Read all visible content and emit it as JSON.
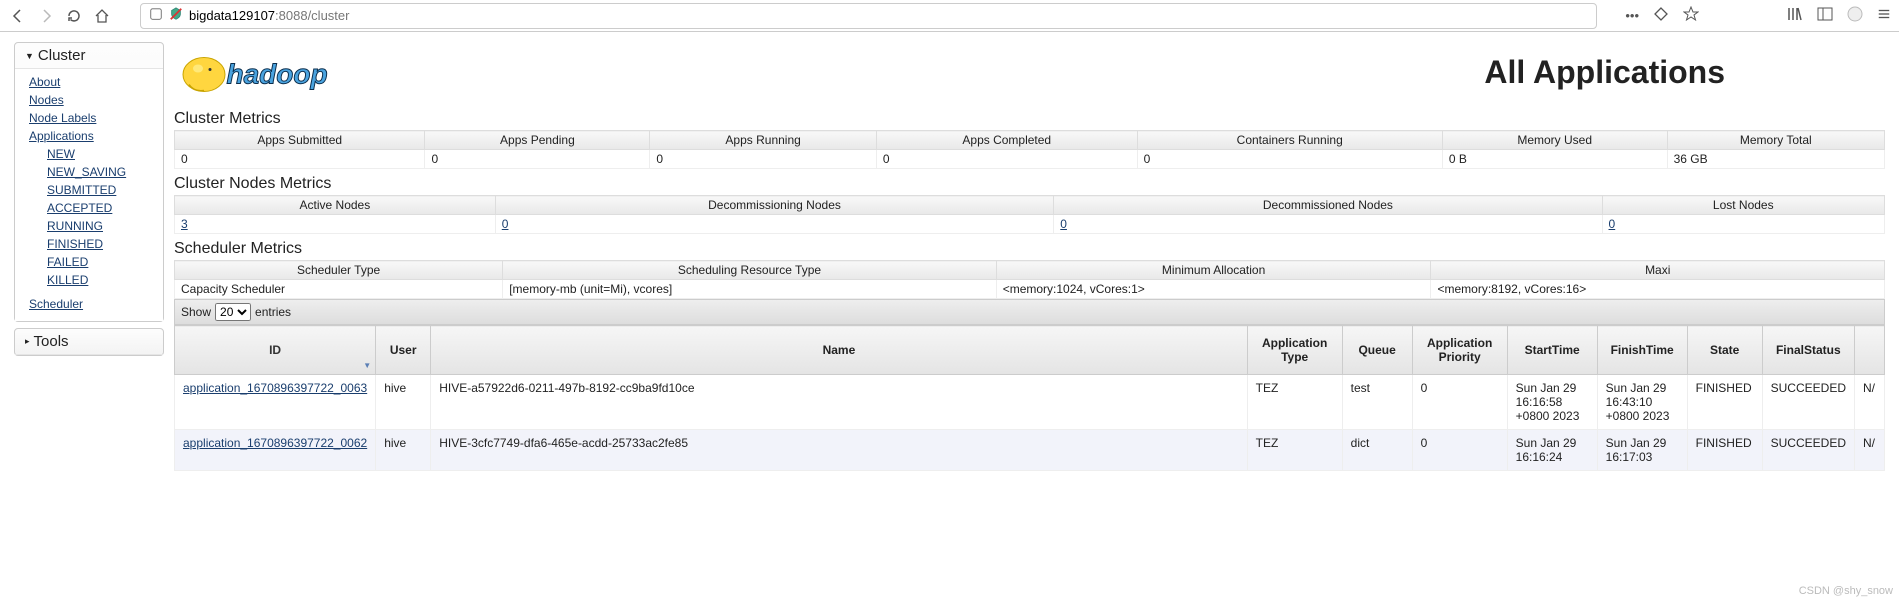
{
  "browser": {
    "url_host": "bigdata129107",
    "url_rest": ":8088/cluster"
  },
  "page": {
    "title": "All Applications"
  },
  "sidebar": {
    "panels": [
      {
        "title": "Cluster"
      },
      {
        "title": "Tools"
      }
    ],
    "cluster_links": [
      "About",
      "Nodes",
      "Node Labels",
      "Applications"
    ],
    "app_states": [
      "NEW",
      "NEW_SAVING",
      "SUBMITTED",
      "ACCEPTED",
      "RUNNING",
      "FINISHED",
      "FAILED",
      "KILLED"
    ],
    "scheduler_link": "Scheduler"
  },
  "cluster_metrics": {
    "heading": "Cluster Metrics",
    "headers": [
      "Apps Submitted",
      "Apps Pending",
      "Apps Running",
      "Apps Completed",
      "Containers Running",
      "Memory Used",
      "Memory Total"
    ],
    "values": [
      "0",
      "0",
      "0",
      "0",
      "0",
      "0 B",
      "36 GB"
    ]
  },
  "nodes_metrics": {
    "heading": "Cluster Nodes Metrics",
    "headers": [
      "Active Nodes",
      "Decommissioning Nodes",
      "Decommissioned Nodes",
      "Lost Nodes"
    ],
    "values": [
      "3",
      "0",
      "0",
      "0"
    ]
  },
  "scheduler_metrics": {
    "heading": "Scheduler Metrics",
    "headers": [
      "Scheduler Type",
      "Scheduling Resource Type",
      "Minimum Allocation",
      "Maxi"
    ],
    "values": [
      "Capacity Scheduler",
      "[memory-mb (unit=Mi), vcores]",
      "<memory:1024, vCores:1>",
      "<memory:8192, vCores:16>"
    ]
  },
  "datatable": {
    "show_label": "Show",
    "entries_label": "entries",
    "page_size": "20",
    "columns": [
      "ID",
      "User",
      "Name",
      "Application Type",
      "Queue",
      "Application Priority",
      "StartTime",
      "FinishTime",
      "State",
      "FinalStatus",
      ""
    ],
    "rows": [
      {
        "id": "application_1670896397722_0063",
        "user": "hive",
        "name": "HIVE-a57922d6-0211-497b-8192-cc9ba9fd10ce",
        "type": "TEZ",
        "queue": "test",
        "priority": "0",
        "start": "Sun Jan 29 16:16:58 +0800 2023",
        "finish": "Sun Jan 29 16:43:10 +0800 2023",
        "state": "FINISHED",
        "final": "SUCCEEDED",
        "extra": "N/"
      },
      {
        "id": "application_1670896397722_0062",
        "user": "hive",
        "name": "HIVE-3cfc7749-dfa6-465e-acdd-25733ac2fe85",
        "type": "TEZ",
        "queue": "dict",
        "priority": "0",
        "start": "Sun Jan 29 16:16:24",
        "finish": "Sun Jan 29 16:17:03",
        "state": "FINISHED",
        "final": "SUCCEEDED",
        "extra": "N/"
      }
    ]
  },
  "watermark": "CSDN @shy_snow"
}
